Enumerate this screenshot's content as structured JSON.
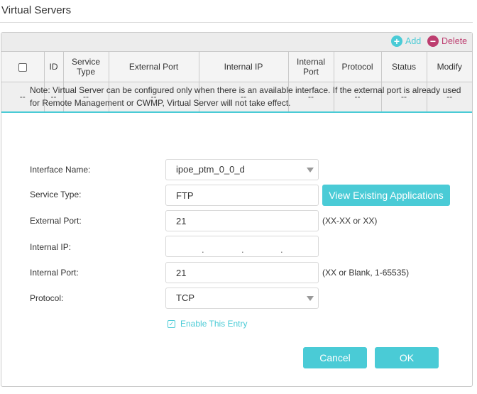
{
  "page_title": "Virtual Servers",
  "toolbar": {
    "add_label": "Add",
    "delete_label": "Delete"
  },
  "table": {
    "headers": [
      "ID",
      "Service Type",
      "External Port",
      "Internal IP",
      "Internal Port",
      "Protocol",
      "Status",
      "Modify"
    ],
    "row": [
      "--",
      "--",
      "--",
      "--",
      "--",
      "--",
      "--",
      "--",
      "--"
    ]
  },
  "note": "Note: Virtual Server can be configured only when there is an available interface. If the external port is already used for Remote Management or CWMP, Virtual Server will not take effect.",
  "form": {
    "interface_name": {
      "label": "Interface Name:",
      "value": "ipoe_ptm_0_0_d"
    },
    "service_type": {
      "label": "Service Type:",
      "value": "FTP",
      "button": "View Existing Applications"
    },
    "external_port": {
      "label": "External Port:",
      "value": "21",
      "hint": "(XX-XX or XX)"
    },
    "internal_ip": {
      "label": "Internal IP:",
      "value": "",
      "dot": "."
    },
    "internal_port": {
      "label": "Internal Port:",
      "value": "21",
      "hint": "(XX or Blank, 1-65535)"
    },
    "protocol": {
      "label": "Protocol:",
      "value": "TCP"
    },
    "enable_entry": {
      "label": "Enable This Entry",
      "checked": true,
      "check_glyph": "✓"
    }
  },
  "actions": {
    "cancel": "Cancel",
    "ok": "OK"
  },
  "colors": {
    "accent": "#4acbd6",
    "delete": "#bd3d6f"
  }
}
